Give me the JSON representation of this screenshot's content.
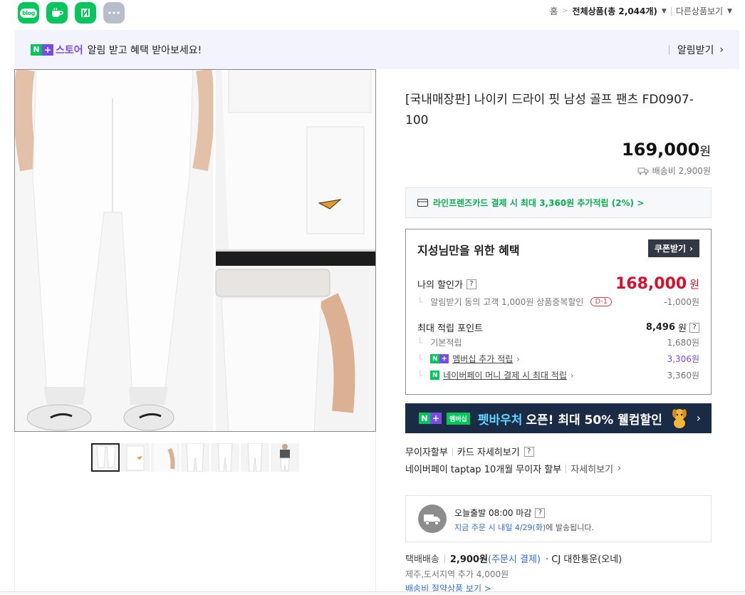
{
  "share": {
    "blog_label": "blog",
    "icons": [
      "blog-icon",
      "cafe-icon",
      "book-icon",
      "more-icon"
    ]
  },
  "breadcrumb": {
    "home": "홈",
    "current": "전체상품(총 2,044개)",
    "other": "다른상품보기"
  },
  "store_banner": {
    "n": "N",
    "plus": "+",
    "store_name": "스토어",
    "message": "알림 받고 혜택 받아보세요!",
    "alarm_label": "알림받기"
  },
  "product": {
    "title": "[국내매장판] 나이키 드라이 핏 남성 골프 팬츠 FD0907-100",
    "price": "169,000",
    "won": "원",
    "shipping_fee": "배송비 2,900원"
  },
  "thumbnails": {
    "count": 7,
    "selected_index": 0
  },
  "card_promo": "라인프렌즈카드 결제 시 최대 3,360원 추가적립 (2%) >",
  "benefit": {
    "heading": "지성님만을 위한 혜택",
    "coupon_label": "쿠폰받기",
    "my_discount_label": "나의 할인가",
    "my_discount_price": "168,000",
    "won": "원",
    "alarm_sub": "알림받기 동의 고객 1,000원 상품중복할인",
    "alarm_tag": "D-1",
    "alarm_amount": "-1,000원",
    "max_points_label": "최대 적립 포인트",
    "max_points_value": "8,496",
    "basic_label": "기본적립",
    "basic_value": "1,680원",
    "membership_label": "멤버십 추가 적립",
    "membership_value": "3,306원",
    "npay_label": "네이버페이 머니 결제 시 최대 적립",
    "npay_value": "3,360원",
    "q": "?"
  },
  "pet_banner": {
    "membership": "멤버십",
    "highlight": "펫바우처",
    "text": "오픈! 최대 50% 웰컴할인"
  },
  "payment": {
    "installment": "무이자할부",
    "card_detail": "카드 자세히보기",
    "taptap": "네이버페이 taptap 10개월 무이자 할부",
    "detail": "자세히보기"
  },
  "delivery": {
    "line1": "오늘출발 08:00 마감",
    "line2_blue": "지금 주문 시 내일 4/29(화)",
    "line2_rest": "에 발송됩니다."
  },
  "shipping": {
    "label": "택배배송",
    "fee": "2,900원",
    "when": "(주문시 결제)",
    "carrier": "· CJ 대한통운(오네)",
    "extra": "제주,도서지역 추가 4,000원",
    "save_link": "배송비 절약상품 보기 >"
  },
  "colors": {
    "naver_green": "#03c75a",
    "store_purple": "#7b4be9",
    "price_red": "#d60f2b",
    "link_blue": "#2f6dd8",
    "pet_bg": "#1a2b45"
  }
}
